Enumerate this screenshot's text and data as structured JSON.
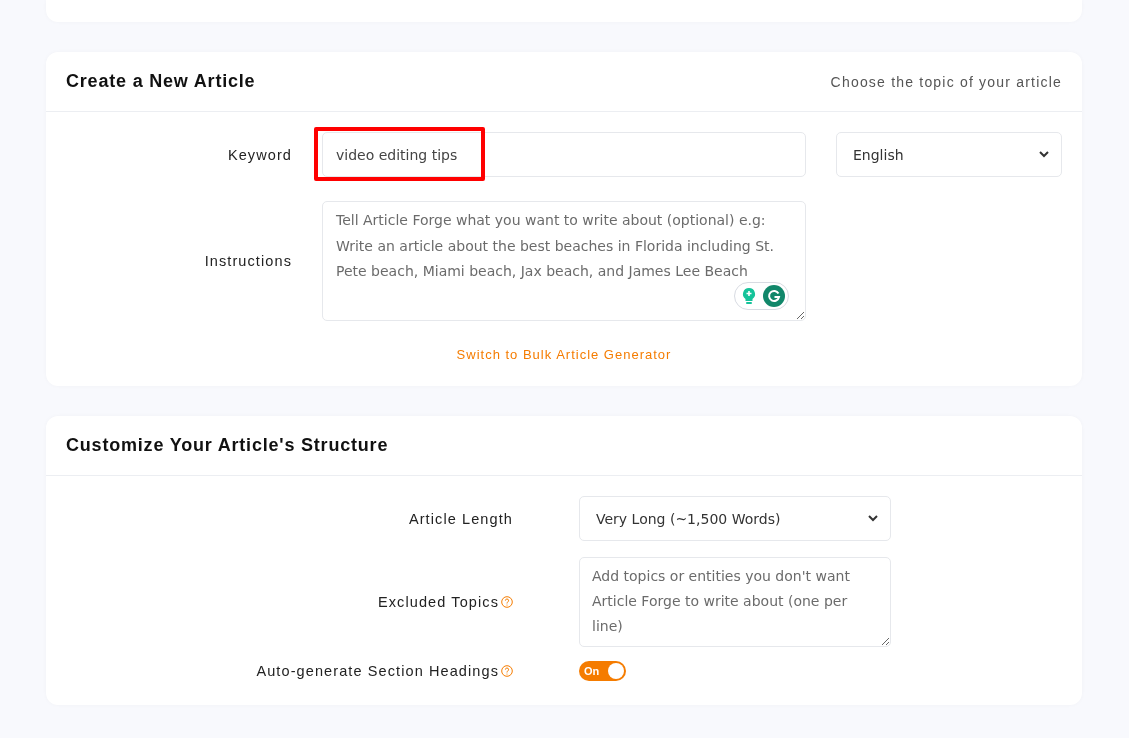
{
  "article_card": {
    "title": "Create a New Article",
    "subtitle": "Choose the topic of your article",
    "keyword": {
      "label": "Keyword",
      "value": "video editing tips",
      "highlighted": true
    },
    "language": {
      "value": "English"
    },
    "instructions": {
      "label": "Instructions",
      "placeholder": "Tell Article Forge what you want to write about (optional) e.g: Write an article about the best beaches in Florida including St. Pete beach, Miami beach, Jax beach, and James Lee Beach"
    },
    "bulk_link": "Switch to Bulk Article Generator"
  },
  "structure_card": {
    "title": "Customize Your Article's Structure",
    "rows": [
      {
        "kind": "select",
        "label": "Article Length",
        "help": false,
        "value": "Very Long (~1,500 Words)"
      },
      {
        "kind": "textarea",
        "label": "Excluded Topics",
        "help": true,
        "placeholder": "Add topics or entities you don't want Article Forge to write about (one per line)"
      },
      {
        "kind": "toggle",
        "label": "Auto-generate Section Headings",
        "help": true,
        "on": true,
        "toggle_text": "On"
      }
    ]
  }
}
